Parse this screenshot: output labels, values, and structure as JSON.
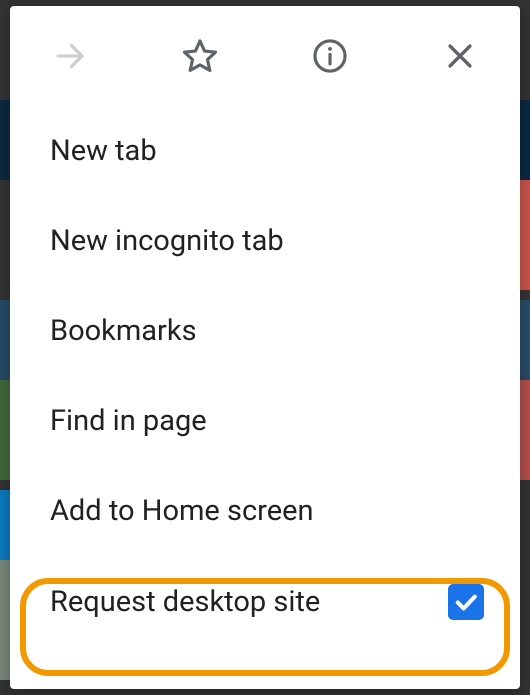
{
  "menu": {
    "items": [
      {
        "label": "New tab"
      },
      {
        "label": "New incognito tab"
      },
      {
        "label": "Bookmarks"
      },
      {
        "label": "Find in page"
      },
      {
        "label": "Add to Home screen"
      },
      {
        "label": "Request desktop site"
      }
    ],
    "request_desktop_checked": true
  },
  "icons": {
    "forward": "forward-arrow",
    "star": "bookmark-star",
    "info": "info-circle",
    "close": "close-x"
  }
}
